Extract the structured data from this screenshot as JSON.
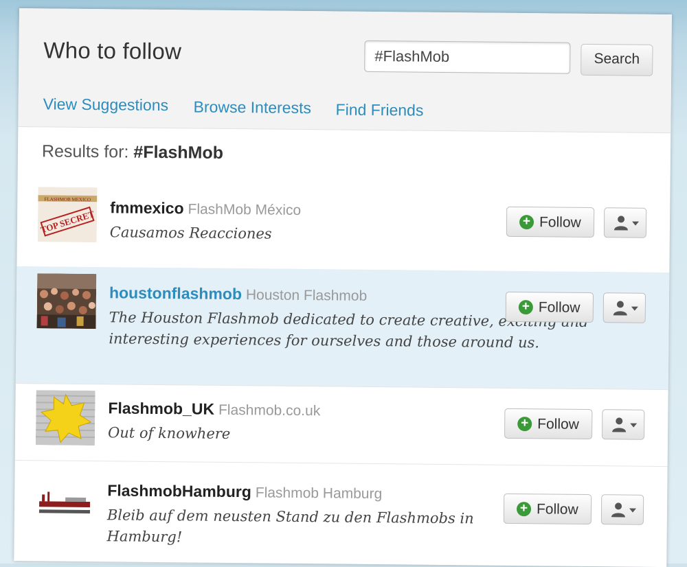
{
  "panel": {
    "title": "Who to follow",
    "search": {
      "value": "#FlashMob",
      "button": "Search"
    },
    "tabs": [
      "View Suggestions",
      "Browse Interests",
      "Find Friends"
    ],
    "results_prefix": "Results for:",
    "results_query": "#FlashMob"
  },
  "users": [
    {
      "username": "fmmexico",
      "fullname": "FlashMob México",
      "bio": "Causamos Reacciones",
      "follow": "Follow",
      "avatar_text": "TOP SECRET",
      "avatar_caption": "FLASHMOB MEXICO"
    },
    {
      "username": "houstonflashmob",
      "fullname": "Houston Flashmob",
      "bio": "The Houston Flashmob dedicated to create creative, exciting and interesting experiences for ourselves and those around us.",
      "follow": "Follow"
    },
    {
      "username": "Flashmob_UK",
      "fullname": "Flashmob.co.uk",
      "bio": "Out of knowhere",
      "follow": "Follow"
    },
    {
      "username": "FlashmobHamburg",
      "fullname": "Flashmob Hamburg",
      "bio": "Bleib auf dem neusten Stand zu den Flashmobs in Hamburg!",
      "follow": "Follow"
    }
  ],
  "colors": {
    "link": "#2b8cbd",
    "follow_plus": "#3a9a38",
    "highlight": "#e3f0f7"
  },
  "icons": {
    "follow": "plus-circle-icon",
    "user_menu": "person-dropdown-icon"
  }
}
